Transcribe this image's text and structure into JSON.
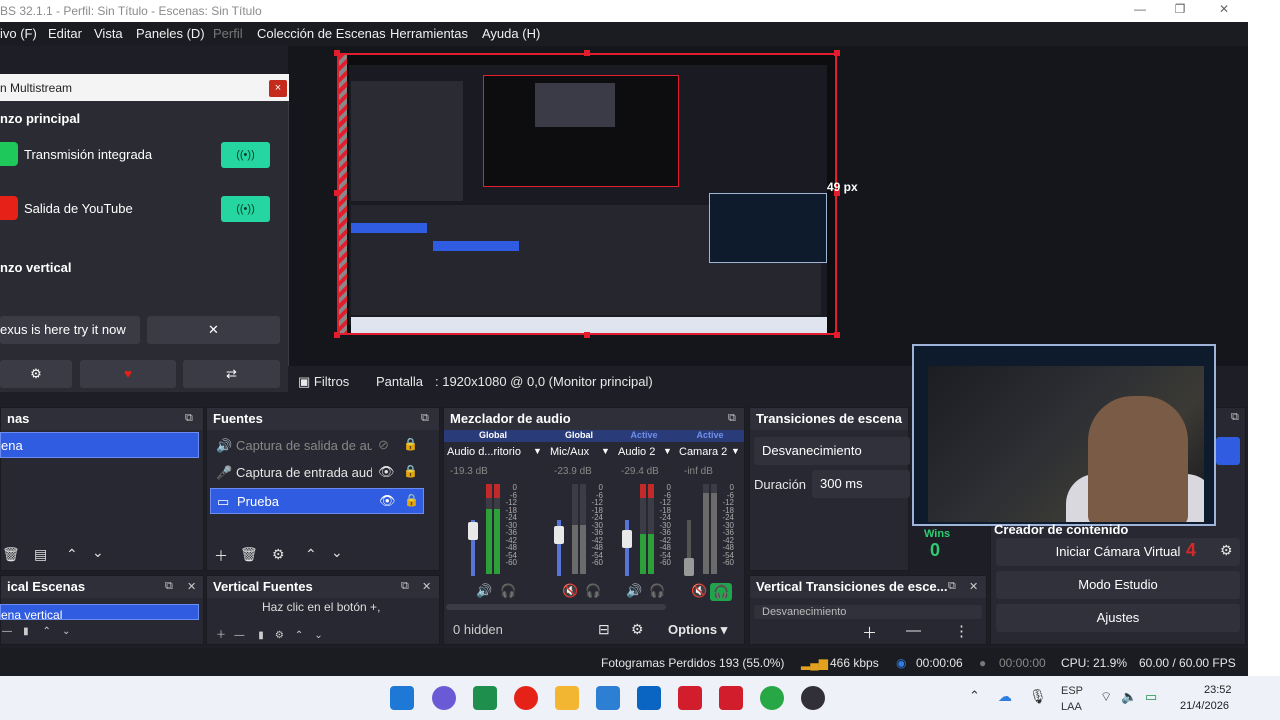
{
  "window": {
    "title": "BS 32.1.1 - Perfil: Sin Título - Escenas: Sin Título",
    "min": "—",
    "max": "❐",
    "close": "✕"
  },
  "menu": [
    "ivo (F)",
    "Editar",
    "Vista",
    "Paneles (D)",
    "Perfil",
    "Colección de Escenas",
    "Herramientas",
    "Ayuda (H)"
  ],
  "multistream": {
    "title": "n Multistream",
    "close": "×",
    "section_main": "nzo principal",
    "outputs": [
      {
        "label": "Transmisión integrada",
        "toggle": "((•))",
        "icon_color": "#1ec85a"
      },
      {
        "label": "Salida de YouTube",
        "toggle": "((•))",
        "icon_color": "#e62117"
      }
    ],
    "section_vertical": "nzo vertical",
    "promo": "exus is here try it now",
    "promo_close": "✕",
    "settings_icon": "⚙",
    "heart_icon": "♥",
    "refresh_icon": "⇄"
  },
  "preview": {
    "offset_label": "49 px"
  },
  "toolbar": {
    "filters": "Filtros",
    "screen": "Pantalla",
    "display_info": ": 1920x1080 @ 0,0 (Monitor principal)"
  },
  "scenes": {
    "title": "nas",
    "items": [
      "ena"
    ]
  },
  "sources": {
    "title": "Fuentes",
    "items": [
      {
        "label": "Captura de salida de audi",
        "icon": "🔊",
        "hidden": true
      },
      {
        "label": "Captura de entrada audi",
        "icon": "🎤",
        "hidden": false
      },
      {
        "label": "Prueba",
        "icon": "▭",
        "hidden": false
      }
    ]
  },
  "mixer": {
    "title": "Mezclador de audio",
    "channels": [
      {
        "tag": "Global",
        "tag_color": "#ffffff",
        "name": "Audio d...ritorio",
        "db": "-19.3 dB",
        "muted": false,
        "level": 0.72
      },
      {
        "tag": "Global",
        "tag_color": "#ffffff",
        "name": "Mic/Aux",
        "db": "-23.9 dB",
        "muted": true,
        "level": 0.55
      },
      {
        "tag": "Active",
        "tag_color": "#6e8fe8",
        "name": "Audio 2",
        "db": "-29.4 dB",
        "muted": false,
        "level": 0.45
      },
      {
        "tag": "Active",
        "tag_color": "#6e8fe8",
        "name": "Camara 2",
        "db": "-inf dB",
        "muted": true,
        "level": 0.0
      }
    ],
    "scale": [
      "0",
      "-6",
      "-12",
      "-18",
      "-24",
      "-30",
      "-36",
      "-42",
      "-48",
      "-54",
      "-60"
    ],
    "hidden": "0 hidden",
    "options": "Options"
  },
  "transitions": {
    "title": "Transiciones de escena",
    "type": "Desvanecimiento",
    "duration_label": "Duración",
    "duration_value": "300 ms"
  },
  "vertical": {
    "scenes_title": "ical Escenas",
    "scenes_item": "ena vertical",
    "sources_title": "Vertical Fuentes",
    "sources_hint": "Haz clic en el botón +,",
    "transitions_title": "Vertical Transiciones de esce...",
    "transitions_value": "Desvanecimiento"
  },
  "controls": {
    "virtual_cam": "Iniciar Cámara Virtual",
    "studio_mode": "Modo Estudio",
    "settings": "Ajustes"
  },
  "overlay": {
    "creator": "Creador de contenido",
    "wins_label": "Wins",
    "wins": "0",
    "losses": "4"
  },
  "status": {
    "dropped": "Fotogramas Perdidos 193 (55.0%)",
    "bitrate": "466 kbps",
    "stream_time": "00:00:06",
    "rec_time": "00:00:00",
    "cpu": "CPU: 21.9%",
    "fps": "60.00 / 60.00 FPS"
  },
  "taskbar": {
    "lang1": "ESP",
    "lang2": "LAA",
    "time": "23:52",
    "date": "21/4/2026",
    "icons": [
      {
        "name": "windows",
        "color": "#1e78d6"
      },
      {
        "name": "copilot",
        "color": "#6a5ad6"
      },
      {
        "name": "excel-like",
        "color": "#1f8f4e"
      },
      {
        "name": "youtube",
        "color": "#e62117"
      },
      {
        "name": "folder",
        "color": "#f2b632"
      },
      {
        "name": "store",
        "color": "#2d7fd3"
      },
      {
        "name": "outlook",
        "color": "#0a64c2"
      },
      {
        "name": "rsa",
        "color": "#d21d2d"
      },
      {
        "name": "pdf",
        "color": "#d21d2d"
      },
      {
        "name": "chrome",
        "color": "#27a745"
      },
      {
        "name": "obs",
        "color": "#303036"
      }
    ]
  },
  "colors": {
    "accent": "#2f5ce0",
    "record_red": "#e21d2d",
    "toggle_green": "#25d6a0"
  }
}
